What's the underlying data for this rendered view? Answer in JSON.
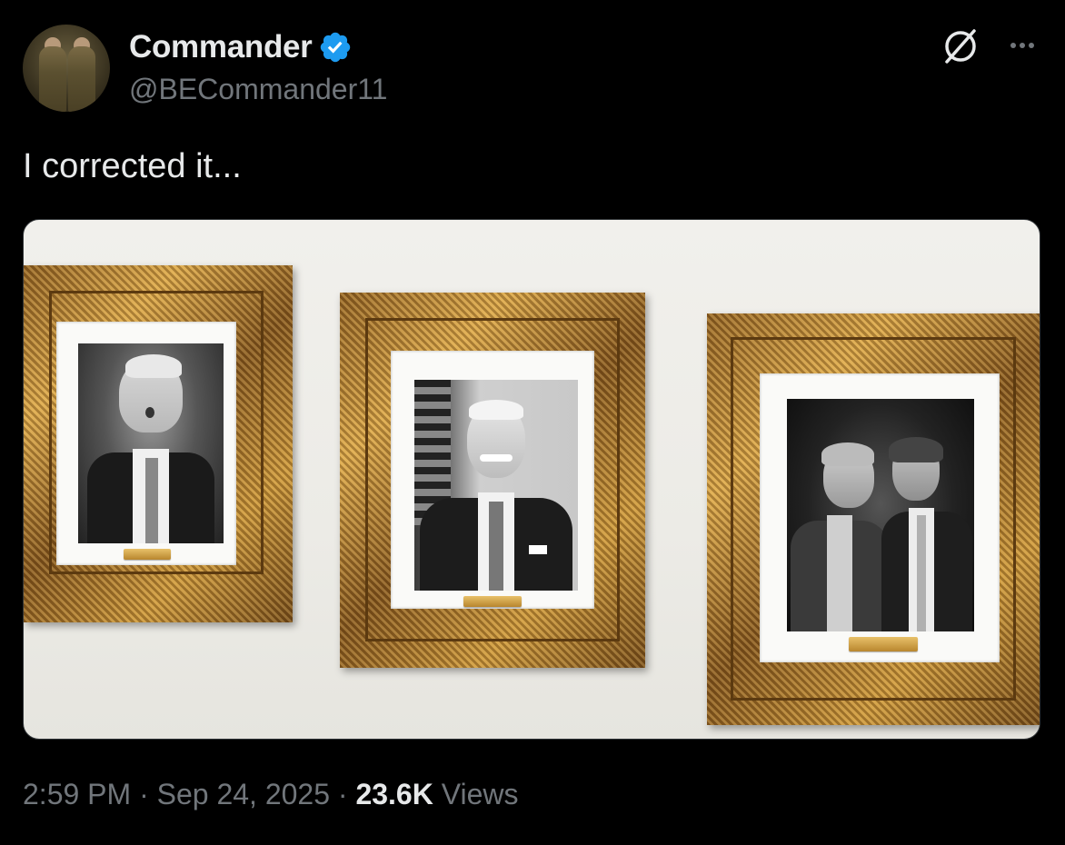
{
  "author": {
    "display_name": "Commander",
    "handle": "@BECommander11",
    "verified": true,
    "verified_color": "#1d9bf0"
  },
  "tweet": {
    "text": "I corrected it..."
  },
  "media": {
    "frames": [
      {
        "plaque_icon": "plaque"
      },
      {
        "plaque_icon": "plaque"
      },
      {
        "plaque_icon": "plaque"
      }
    ]
  },
  "meta": {
    "time": "2:59 PM",
    "separator": "·",
    "date": "Sep 24, 2025",
    "views_count": "23.6K",
    "views_label": "Views"
  },
  "icons": {
    "grok": "grok-icon",
    "more": "more-icon",
    "verified": "verified-badge-icon"
  }
}
